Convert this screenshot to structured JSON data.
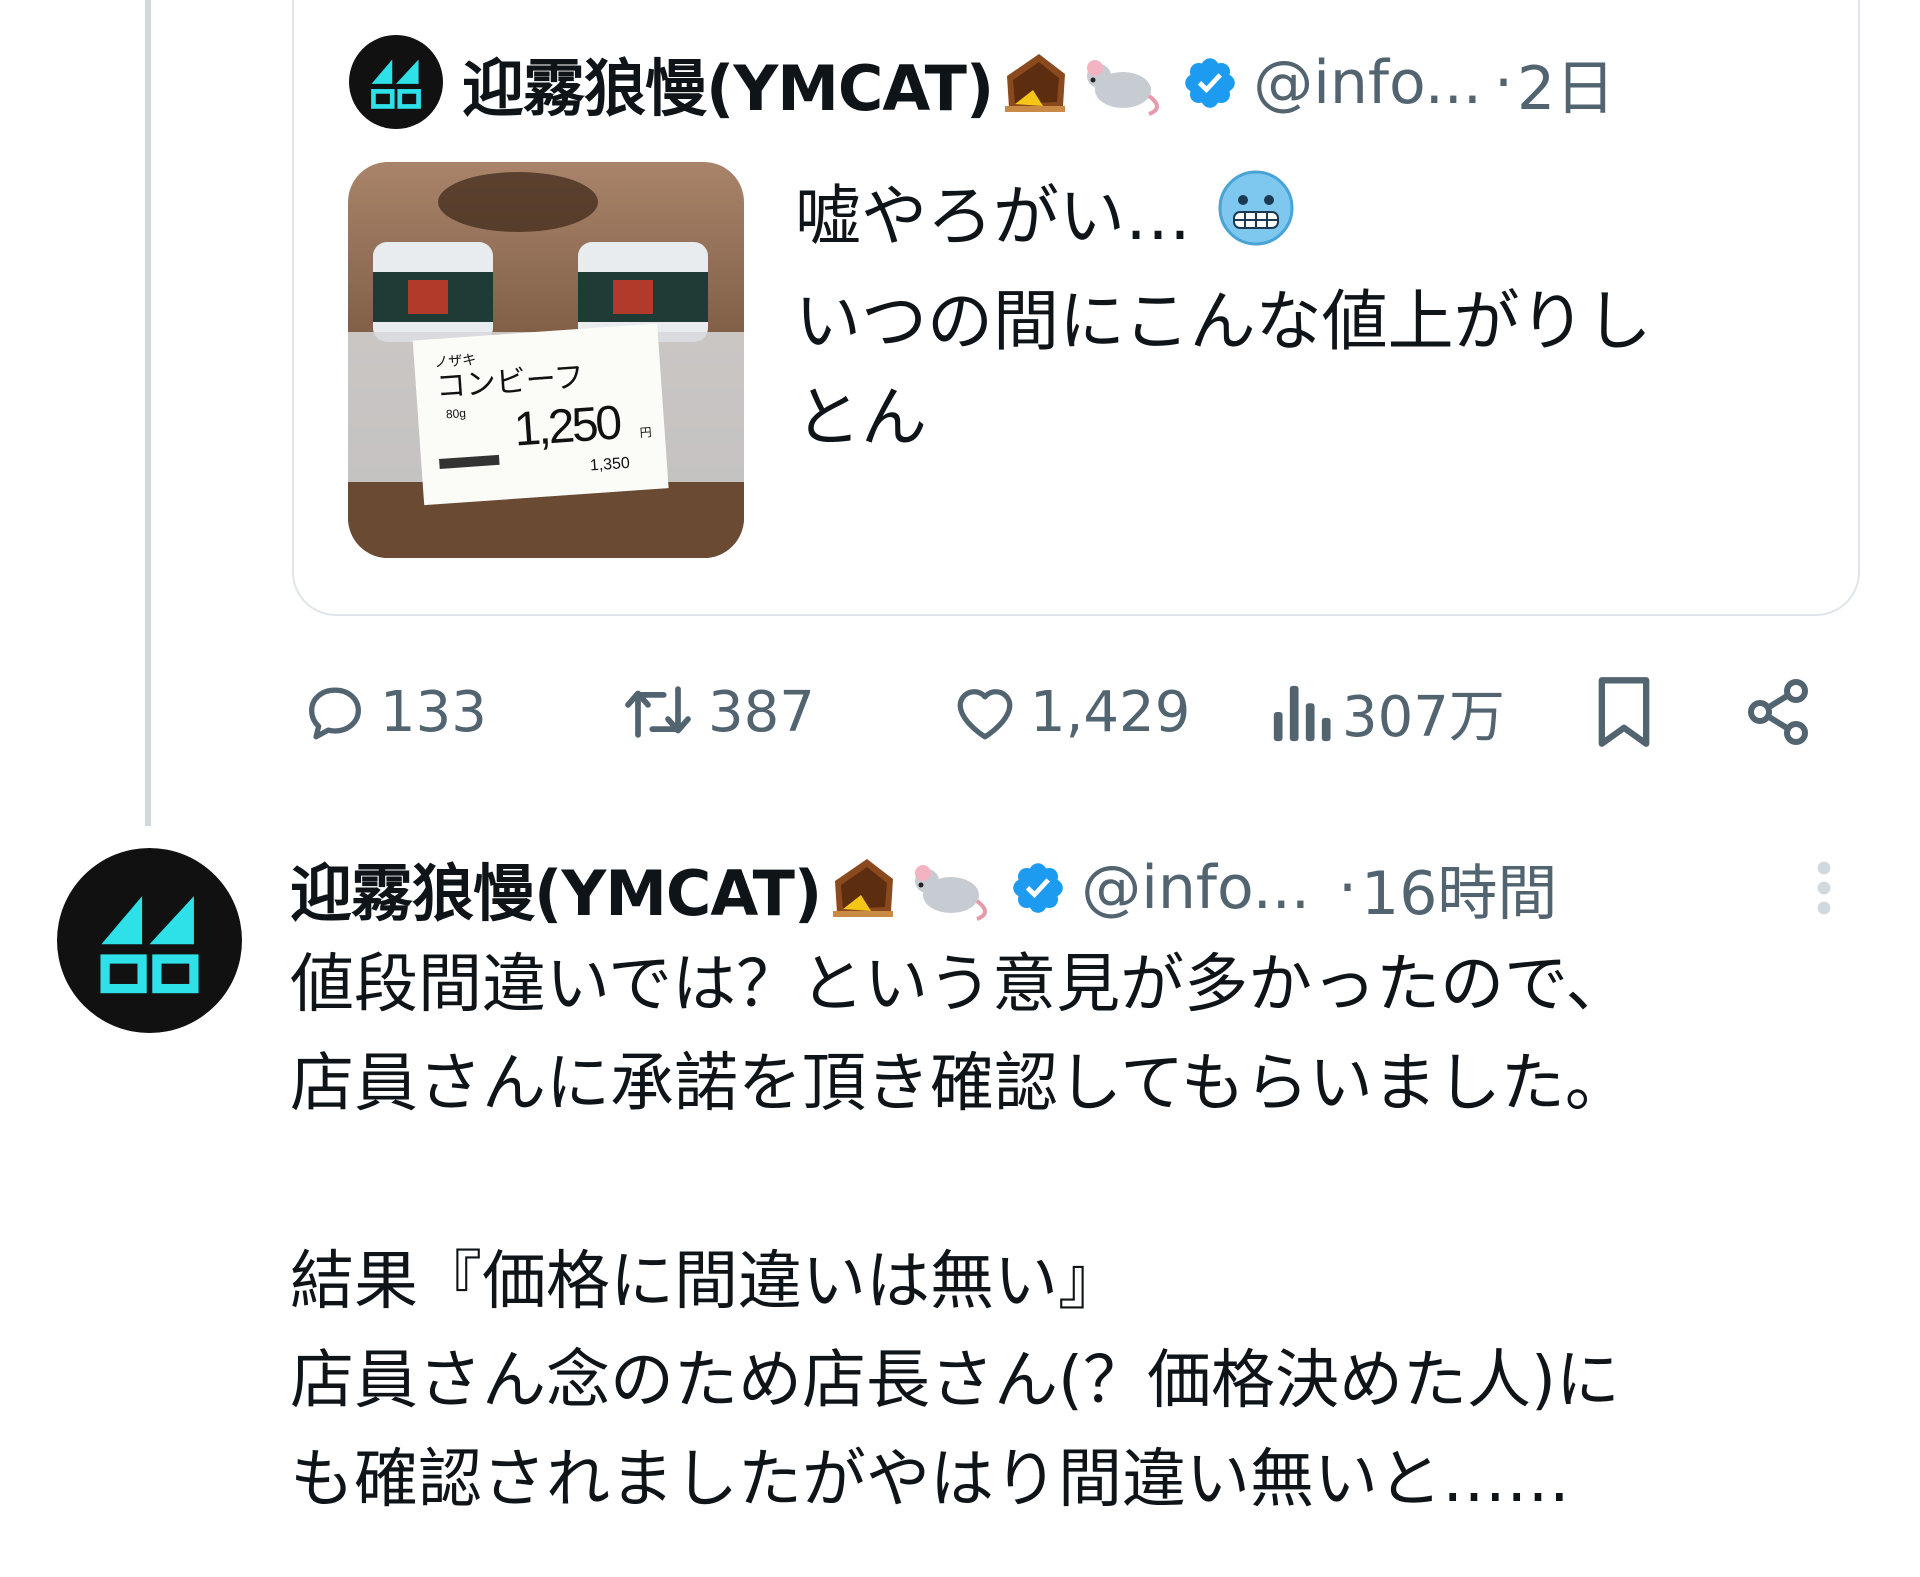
{
  "quoted_tweet": {
    "author_name": "迎霧狼慢(YMCAT)",
    "author_emojis": [
      "mousetrap-icon",
      "mouse-icon"
    ],
    "verified": true,
    "handle": "@info...",
    "separator": "·",
    "time": "2日",
    "image_alt": "price-tag-photo",
    "photo_text": {
      "brand": "ノザキ",
      "product": "コンビーフ",
      "weight": "80g",
      "price": "1,250",
      "price_unit": "円",
      "tax_price": "1,350"
    },
    "text_lines": [
      "嘘やろがい…",
      "いつの間にこんな値上がりし",
      "とん"
    ],
    "text_emoji": "grimacing-cold-face-icon"
  },
  "actions": {
    "replies": "133",
    "retweets": "387",
    "likes": "1,429",
    "views": "307万"
  },
  "reply_tweet": {
    "author_name": "迎霧狼慢(YMCAT)",
    "author_emojis": [
      "mousetrap-icon",
      "mouse-icon"
    ],
    "verified": true,
    "handle": "@info...",
    "separator": "·",
    "time": "16時間",
    "text_lines": [
      "値段間違いでは？という意見が多かったので、",
      "店員さんに承諾を頂き確認してもらいました。",
      "",
      "結果『価格に間違いは無い』",
      "店員さん念のため店長さん(？価格決めた人)に",
      "も確認されましたがやはり間違い無いと……"
    ]
  },
  "colors": {
    "text": "#0f1419",
    "secondary": "#536471",
    "verified": "#1d9bf0",
    "border": "#dfe5ea",
    "thread_line": "#cfd9de",
    "avatar_bg": "#111111",
    "avatar_accent": "#2ee0e8"
  }
}
